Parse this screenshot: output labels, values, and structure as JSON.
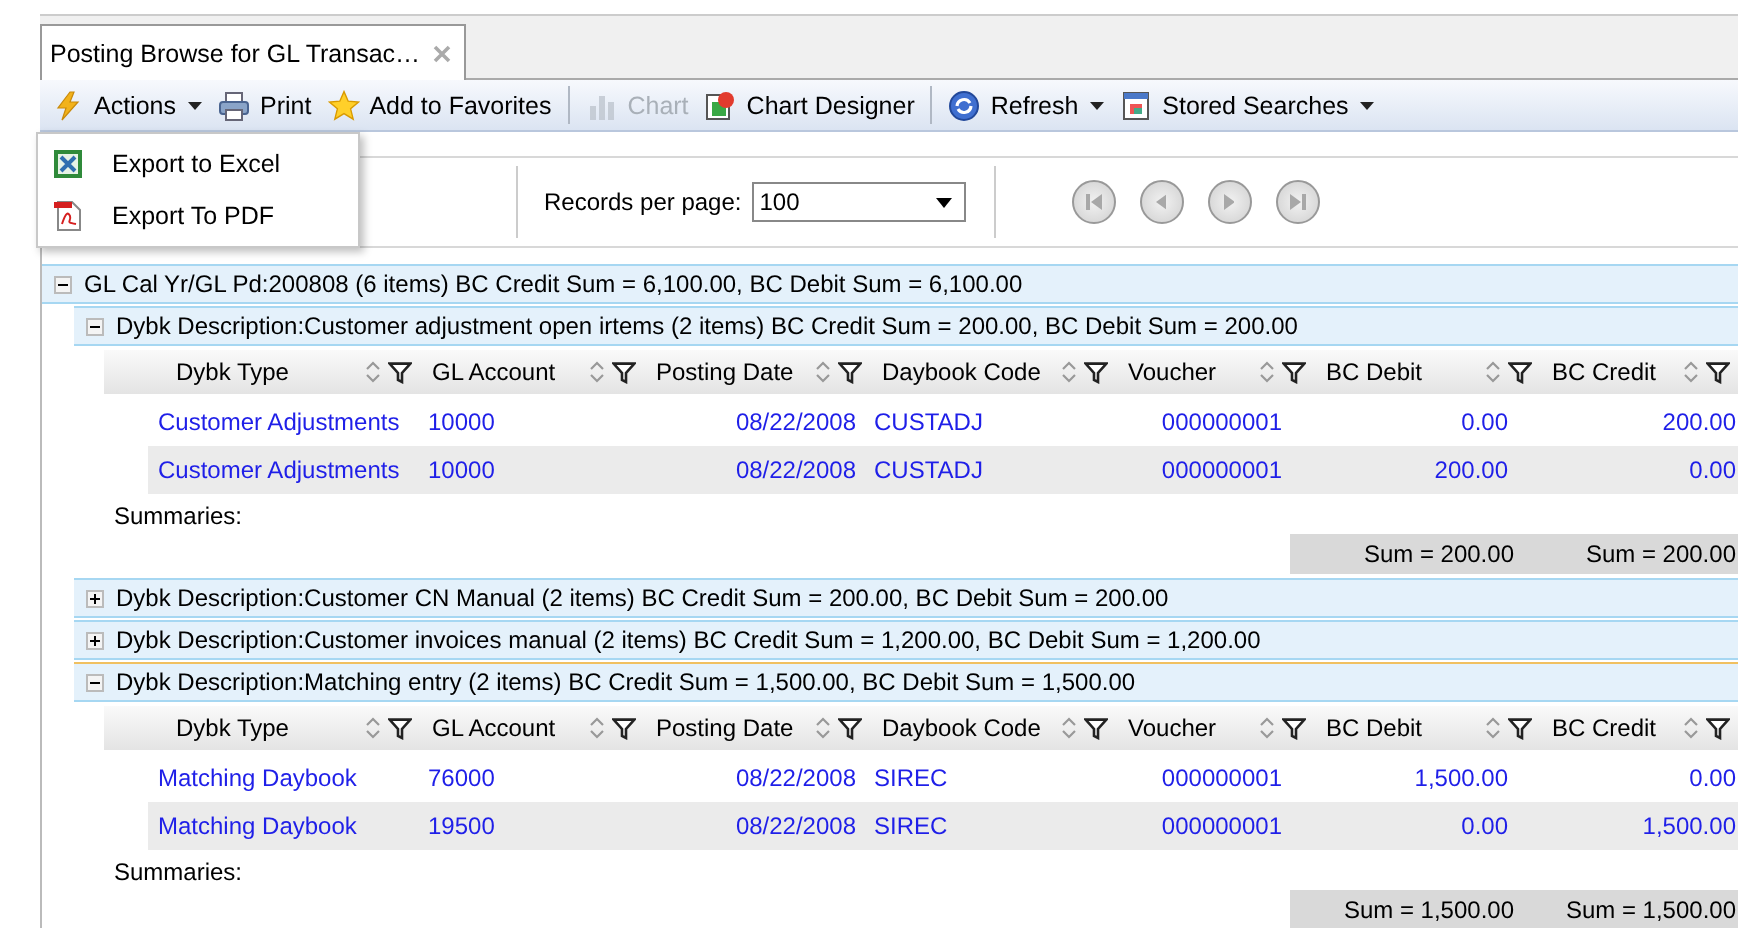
{
  "tab": {
    "title": "Posting Browse for GL Transac…",
    "selected": true
  },
  "toolbar": [
    {
      "kind": "button",
      "label": "Actions",
      "dropdown": true,
      "disabled": false
    },
    {
      "kind": "button",
      "label": "Print",
      "dropdown": false,
      "disabled": false
    },
    {
      "kind": "button",
      "label": "Add to Favorites",
      "dropdown": false,
      "disabled": false
    },
    {
      "kind": "separator"
    },
    {
      "kind": "button",
      "label": "Chart",
      "dropdown": false,
      "disabled": true
    },
    {
      "kind": "button",
      "label": "Chart Designer",
      "dropdown": false,
      "disabled": false
    },
    {
      "kind": "separator"
    },
    {
      "kind": "button",
      "label": "Refresh",
      "dropdown": true,
      "disabled": false
    },
    {
      "kind": "button",
      "label": "Stored Searches",
      "dropdown": true,
      "disabled": false
    }
  ],
  "actions_menu": {
    "open": true,
    "items": [
      {
        "label": "Export to Excel"
      },
      {
        "label": "Export To PDF"
      }
    ]
  },
  "pager": {
    "records_label": "Records per page:",
    "page_size": "100",
    "navigation_disabled": true
  },
  "grid": {
    "groups": [
      {
        "label": "GL Cal Yr/GL Pd:200808 (6 items) BC Credit Sum = 6,100.00, BC Debit Sum = 6,100.00",
        "expanded": true,
        "children": [
          {
            "label": "Dybk Description:Customer adjustment open irtems (2 items) BC Credit Sum = 200.00, BC Debit Sum = 200.00",
            "expanded": true,
            "selected": false,
            "columns": [
              "Dybk Type",
              "GL Account",
              "Posting Date",
              "Daybook Code",
              "Voucher",
              "BC Debit",
              "BC Credit"
            ],
            "rows": [
              [
                "Customer Adjustments",
                "10000",
                "08/22/2008",
                "CUSTADJ",
                "000000001",
                "0.00",
                "200.00"
              ],
              [
                "Customer Adjustments",
                "10000",
                "08/22/2008",
                "CUSTADJ",
                "000000001",
                "200.00",
                "0.00"
              ]
            ],
            "summaries_label": "Summaries:",
            "sums": [
              "Sum = 200.00",
              "Sum = 200.00"
            ]
          },
          {
            "label": "Dybk Description:Customer CN Manual (2 items) BC Credit Sum = 200.00, BC Debit Sum = 200.00",
            "expanded": false,
            "selected": false
          },
          {
            "label": "Dybk Description:Customer invoices manual (2 items) BC Credit Sum = 1,200.00, BC Debit Sum = 1,200.00",
            "expanded": false,
            "selected": false
          },
          {
            "label": "Dybk Description:Matching entry (2 items) BC Credit Sum = 1,500.00, BC Debit Sum = 1,500.00",
            "expanded": true,
            "selected": true,
            "columns": [
              "Dybk Type",
              "GL Account",
              "Posting Date",
              "Daybook Code",
              "Voucher",
              "BC Debit",
              "BC Credit"
            ],
            "rows": [
              [
                "Matching Daybook",
                "76000",
                "08/22/2008",
                "SIREC",
                "000000001",
                "1,500.00",
                "0.00"
              ],
              [
                "Matching Daybook",
                "19500",
                "08/22/2008",
                "SIREC",
                "000000001",
                "0.00",
                "1,500.00"
              ]
            ],
            "summaries_label": "Summaries:",
            "sums": [
              "Sum = 1,500.00",
              "Sum = 1,500.00"
            ]
          }
        ]
      }
    ]
  }
}
